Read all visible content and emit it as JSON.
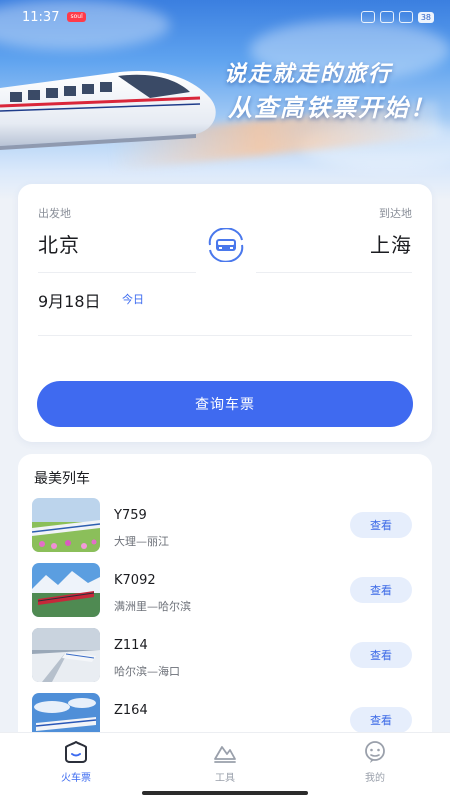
{
  "status_bar": {
    "time": "11:37",
    "badge": "soul",
    "battery": "38"
  },
  "hero": {
    "slogan_line1": "说走就走的旅行",
    "slogan_line2": "从查高铁票开始！"
  },
  "search": {
    "from_label": "出发地",
    "to_label": "到达地",
    "from_city": "北京",
    "to_city": "上海",
    "date": "9月18日",
    "today_tag": "今日",
    "query_button": "查询车票"
  },
  "train_list": {
    "title": "最美列车",
    "view_label": "查看",
    "items": [
      {
        "train_no": "Y759",
        "route": "大理—丽江"
      },
      {
        "train_no": "K7092",
        "route": "满洲里—哈尔滨"
      },
      {
        "train_no": "Z114",
        "route": "哈尔滨—海口"
      },
      {
        "train_no": "Z164",
        "route": ""
      }
    ]
  },
  "bottom_nav": {
    "items": [
      {
        "label": "火车票",
        "icon": "train-ticket-icon",
        "active": true
      },
      {
        "label": "工具",
        "icon": "tools-icon",
        "active": false
      },
      {
        "label": "我的",
        "icon": "profile-icon",
        "active": false
      }
    ]
  },
  "colors": {
    "accent": "#3f6af0",
    "view_button_bg": "#e6eefc",
    "page_bg": "#eef2f8"
  }
}
